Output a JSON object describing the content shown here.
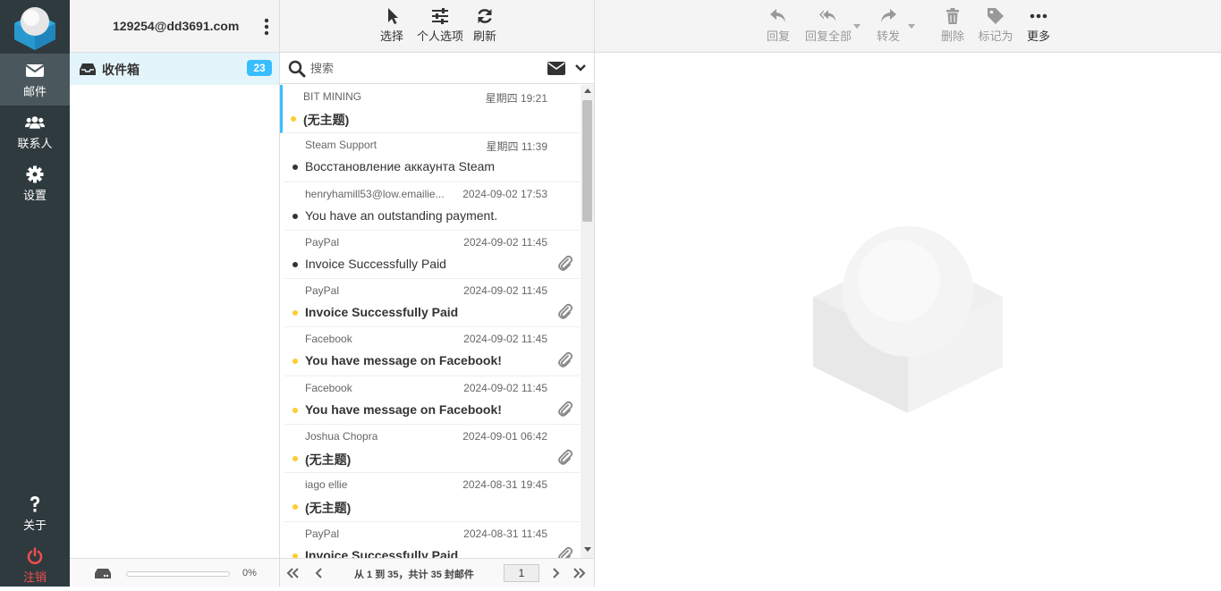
{
  "nav": {
    "items": [
      {
        "label": "邮件",
        "icon": "envelope-icon"
      },
      {
        "label": "联系人",
        "icon": "users-icon"
      },
      {
        "label": "设置",
        "icon": "gear-icon"
      },
      {
        "label": "关于",
        "icon": "question-icon"
      },
      {
        "label": "注销",
        "icon": "power-icon"
      }
    ]
  },
  "account": {
    "email": "129254@dd3691.com"
  },
  "folders": [
    {
      "label": "收件箱",
      "unread": "23",
      "icon": "inbox-icon"
    }
  ],
  "quota": {
    "percent_label": "0%",
    "used_fraction": 0
  },
  "list_toolbar": {
    "select": "选择",
    "options": "个人选项",
    "refresh": "刷新"
  },
  "search": {
    "placeholder": "搜索"
  },
  "messages": [
    {
      "from": "BIT MINING",
      "date": "星期四 19:21",
      "subject": "(无主题)",
      "unread": true,
      "attachment": false,
      "selected": true
    },
    {
      "from": "Steam Support",
      "date": "星期四 11:39",
      "subject": "Восстановление аккаунта Steam",
      "unread": false,
      "attachment": false
    },
    {
      "from": "henryhamill53@low.emailie...",
      "date": "2024-09-02 17:53",
      "subject": "You have an outstanding payment.",
      "unread": false,
      "attachment": false
    },
    {
      "from": "PayPal",
      "date": "2024-09-02 11:45",
      "subject": "Invoice Successfully Paid",
      "unread": false,
      "attachment": true
    },
    {
      "from": "PayPal",
      "date": "2024-09-02 11:45",
      "subject": "Invoice Successfully Paid",
      "unread": true,
      "attachment": true
    },
    {
      "from": "Facebook",
      "date": "2024-09-02 11:45",
      "subject": "You have message on Facebook!",
      "unread": true,
      "attachment": true
    },
    {
      "from": "Facebook",
      "date": "2024-09-02 11:45",
      "subject": "You have message on Facebook!",
      "unread": true,
      "attachment": true
    },
    {
      "from": "Joshua Chopra",
      "date": "2024-09-01 06:42",
      "subject": "(无主题)",
      "unread": true,
      "attachment": true
    },
    {
      "from": "iago ellie",
      "date": "2024-08-31 19:45",
      "subject": "(无主题)",
      "unread": true,
      "attachment": false
    },
    {
      "from": "PayPal",
      "date": "2024-08-31 11:45",
      "subject": "Invoice Successfully Paid",
      "unread": true,
      "attachment": true
    }
  ],
  "pager": {
    "info": "从 1 到 35，共计 35 封邮件",
    "page": "1"
  },
  "preview_toolbar": {
    "reply": "回复",
    "reply_all": "回复全部",
    "forward": "转发",
    "delete": "删除",
    "mark": "标记为",
    "more": "更多"
  },
  "colors": {
    "accent": "#37beff",
    "nav_bg": "#2f3a3f",
    "unread_dot": "#ffcc33",
    "logout": "#f04e4e"
  }
}
